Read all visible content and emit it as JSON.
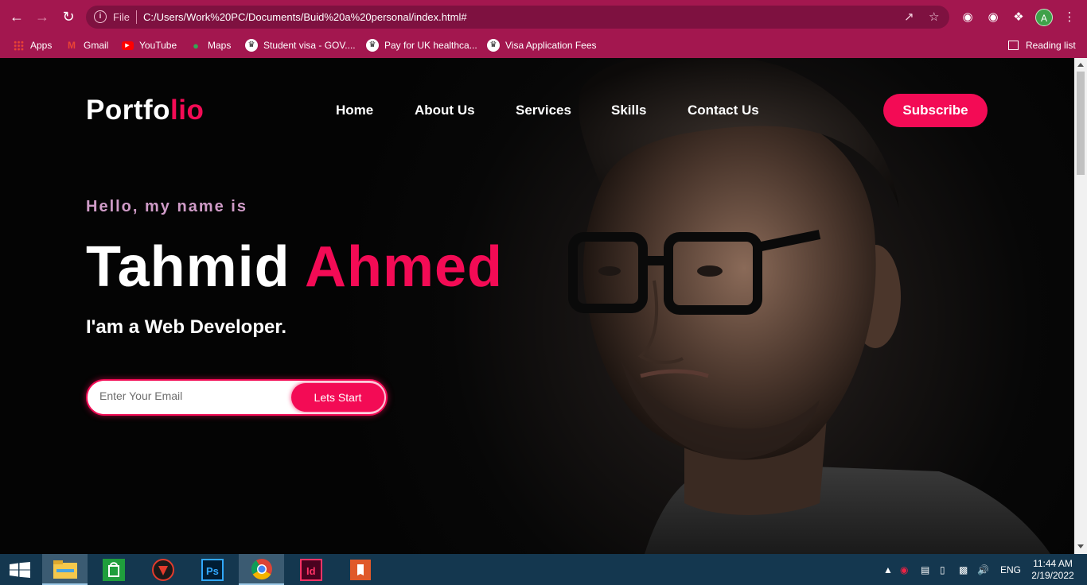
{
  "browser": {
    "omnibox_scheme": "File",
    "url": "C:/Users/Work%20PC/Documents/Buid%20a%20personal/index.html#",
    "bookmarks": [
      {
        "label": "Apps",
        "icon": "apps-grid-icon"
      },
      {
        "label": "Gmail",
        "icon": "gmail-icon"
      },
      {
        "label": "YouTube",
        "icon": "youtube-icon"
      },
      {
        "label": "Maps",
        "icon": "maps-icon"
      },
      {
        "label": "Student visa - GOV....",
        "icon": "gov-crown-icon"
      },
      {
        "label": "Pay for UK healthca...",
        "icon": "gov-crown-icon"
      },
      {
        "label": "Visa Application Fees",
        "icon": "gov-crown-icon"
      }
    ],
    "reading_list": "Reading list",
    "profile_initial": "A",
    "colors": {
      "chrome": "#a3174f",
      "omnibox": "#7e1140"
    }
  },
  "page": {
    "logo": {
      "main": "Portfo",
      "accent": "lio"
    },
    "nav": [
      "Home",
      "About Us",
      "Services",
      "Skills",
      "Contact Us"
    ],
    "subscribe": "Subscribe",
    "greeting": "Hello, my name is",
    "first_name": "Tahmid",
    "last_name": "Ahmed",
    "role": "I'am a Web Developer.",
    "email_placeholder": "Enter Your Email",
    "cta": "Lets Start",
    "colors": {
      "accent": "#f30b55",
      "greeting": "#cf9bc7",
      "background": "#040404"
    }
  },
  "taskbar": {
    "apps": [
      "file-explorer-icon",
      "store-icon",
      "game-app-icon",
      "photoshop-icon",
      "chrome-icon",
      "indesign-icon",
      "acrobat-icon"
    ],
    "language": "ENG",
    "time": "11:44 AM",
    "date": "2/19/2022"
  }
}
